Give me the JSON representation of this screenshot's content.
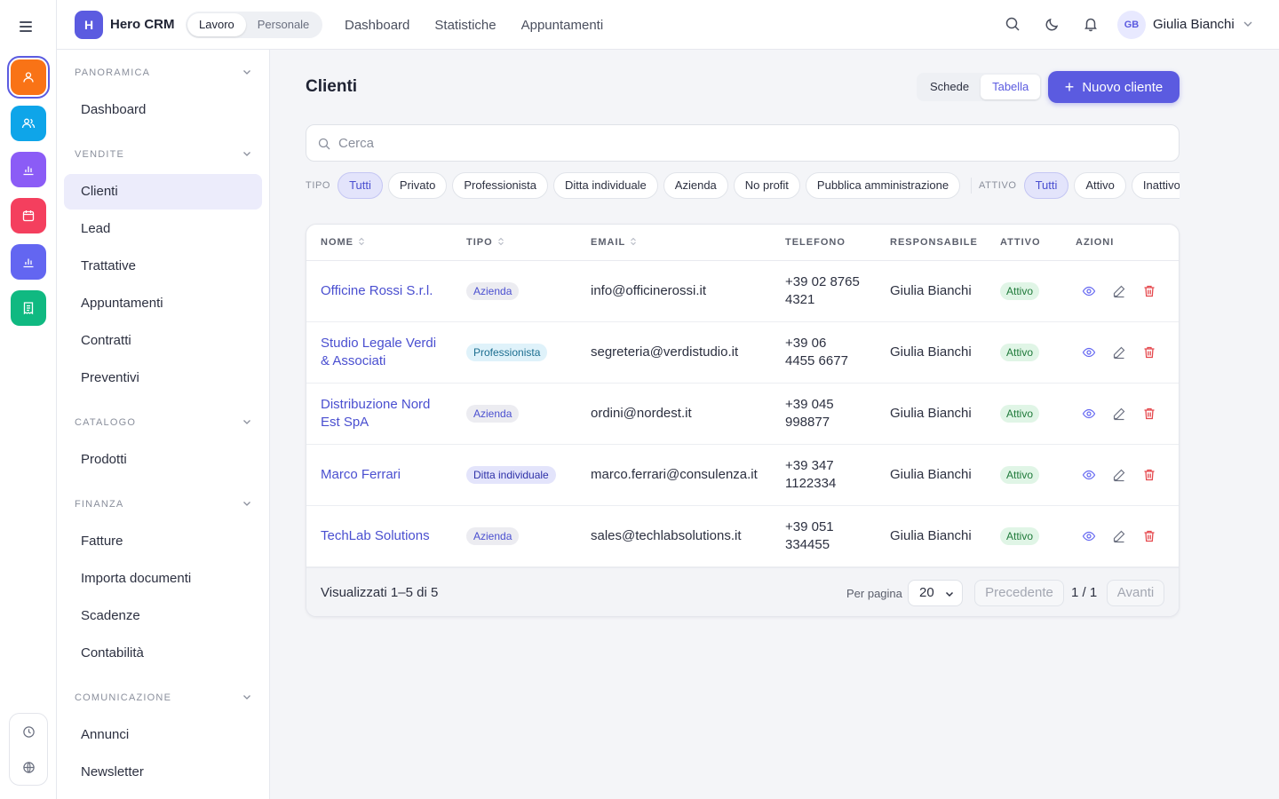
{
  "app": {
    "brand_initial": "H",
    "brand": "Hero CRM",
    "modes": [
      "Lavoro",
      "Personale"
    ],
    "active_mode": "Lavoro",
    "topnav": [
      "Dashboard",
      "Statistiche",
      "Appuntamenti"
    ],
    "user": {
      "initials": "GB",
      "name": "Giulia Bianchi"
    }
  },
  "rail": {
    "items": [
      {
        "name": "users-icon",
        "color": "#f97316"
      },
      {
        "name": "contacts-icon",
        "color": "#0ea5e9"
      },
      {
        "name": "chart-icon",
        "color": "#8b5cf6"
      },
      {
        "name": "calendar-icon",
        "color": "#f43f5e"
      },
      {
        "name": "chart-icon",
        "color": "#6366f1"
      },
      {
        "name": "receipt-icon",
        "color": "#10b981"
      }
    ],
    "bottom": [
      "history-icon",
      "globe-icon"
    ]
  },
  "sidebar": {
    "sections": [
      {
        "title": "PANORAMICA",
        "items": [
          "Dashboard"
        ]
      },
      {
        "title": "VENDITE",
        "items": [
          "Clienti",
          "Lead",
          "Trattative",
          "Appuntamenti",
          "Contratti",
          "Preventivi"
        ]
      },
      {
        "title": "CATALOGO",
        "items": [
          "Prodotti"
        ]
      },
      {
        "title": "FINANZA",
        "items": [
          "Fatture",
          "Importa documenti",
          "Scadenze",
          "Contabilità"
        ]
      },
      {
        "title": "COMUNICAZIONE",
        "items": [
          "Annunci",
          "Newsletter"
        ]
      }
    ],
    "active_item": "Clienti"
  },
  "main": {
    "title": "Clienti",
    "view_options": [
      "Schede",
      "Tabella"
    ],
    "active_view": "Tabella",
    "new_button": "Nuovo cliente",
    "search_placeholder": "Cerca",
    "filters": {
      "type_label": "TIPO",
      "type_options": [
        "Tutti",
        "Privato",
        "Professionista",
        "Ditta individuale",
        "Azienda",
        "No profit",
        "Pubblica amministrazione"
      ],
      "type_selected": "Tutti",
      "active_label": "ATTIVO",
      "active_options": [
        "Tutti",
        "Attivo",
        "Inattivo"
      ],
      "active_selected": "Tutti"
    },
    "table": {
      "columns": [
        "NOME",
        "TIPO",
        "EMAIL",
        "TELEFONO",
        "RESPONSABILE",
        "ATTIVO",
        "AZIONI"
      ],
      "rows": [
        {
          "name": [
            "Officine Rossi S.r.l."
          ],
          "type": "Azienda",
          "email": "info@officinerossi.it",
          "phone": [
            "+39 02 8765",
            "4321"
          ],
          "owner": "Giulia Bianchi",
          "active": "Attivo"
        },
        {
          "name": [
            "Studio Legale Verdi",
            "& Associati"
          ],
          "type": "Professionista",
          "email": "segreteria@verdistudio.it",
          "phone": [
            "+39 06",
            "4455 6677"
          ],
          "owner": "Giulia Bianchi",
          "active": "Attivo"
        },
        {
          "name": [
            "Distribuzione Nord",
            "Est SpA"
          ],
          "type": "Azienda",
          "email": "ordini@nordest.it",
          "phone": [
            "+39 045",
            "998877"
          ],
          "owner": "Giulia Bianchi",
          "active": "Attivo"
        },
        {
          "name": [
            "Marco Ferrari"
          ],
          "type": "Ditta individuale",
          "email": "marco.ferrari@consulenza.it",
          "phone": [
            "+39 347",
            "1122334"
          ],
          "owner": "Giulia Bianchi",
          "active": "Attivo"
        },
        {
          "name": [
            "TechLab Solutions"
          ],
          "type": "Azienda",
          "email": "sales@techlabsolutions.it",
          "phone": [
            "+39 051",
            "334455"
          ],
          "owner": "Giulia Bianchi",
          "active": "Attivo"
        }
      ]
    },
    "pagination": {
      "showing": "Visualizzati 1–5 di 5",
      "per_page_label": "Per pagina",
      "per_page": "20",
      "prev": "Precedente",
      "page_info": "1 / 1",
      "next": "Avanti"
    }
  }
}
